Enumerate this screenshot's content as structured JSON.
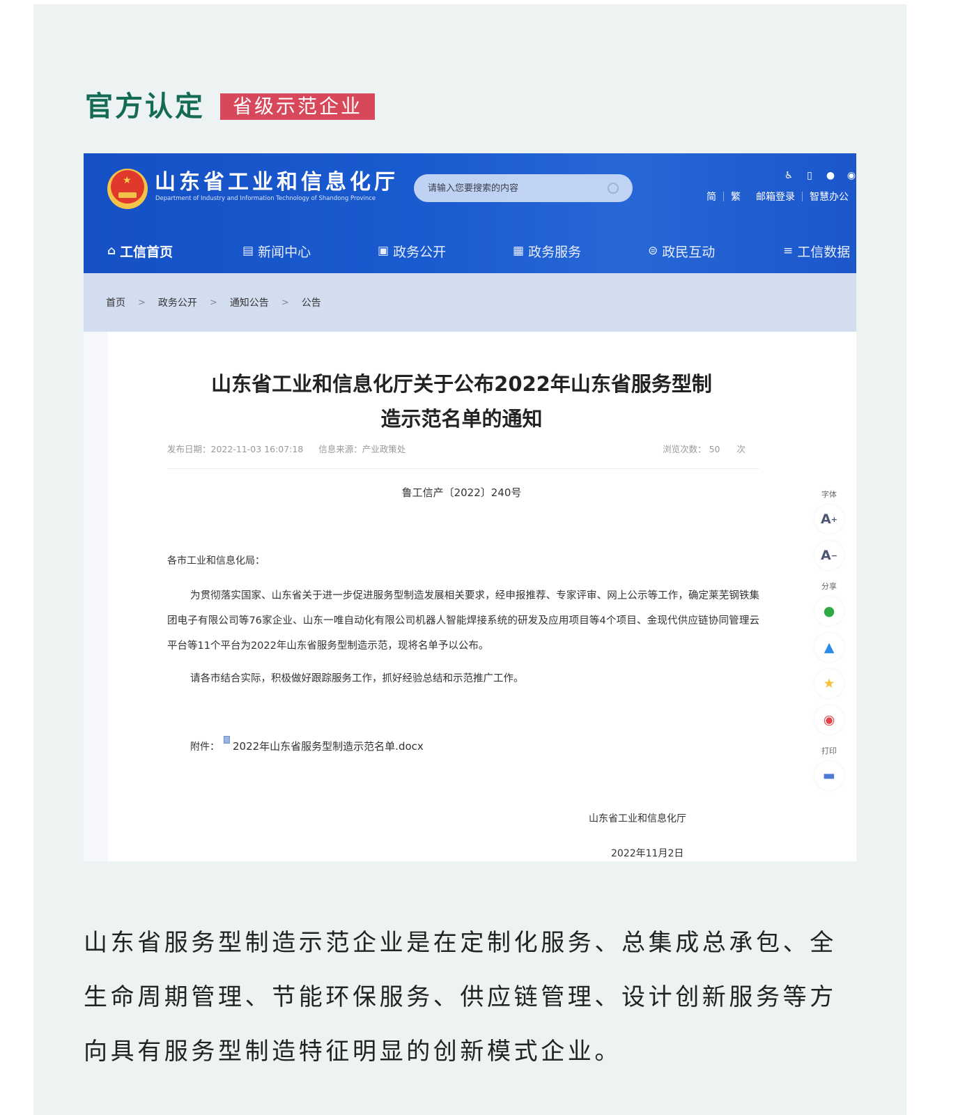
{
  "section": {
    "title": "官方认定",
    "badge": "省级示范企业",
    "colors": {
      "title": "#146b55",
      "badge_bg": "#d6485a"
    }
  },
  "site": {
    "name": "山东省工业和信息化厅",
    "name_en": "Department of Industry and Information Technology of Shandong Province",
    "search_placeholder": "请输入您要搜索的内容",
    "top_icons": [
      "accessibility-icon",
      "mobile-icon",
      "wechat-icon",
      "weibo-icon"
    ],
    "top_links": {
      "simplified": "简",
      "traditional": "繁",
      "mail_login": "邮箱登录",
      "smart_office": "智慧办公"
    },
    "nav": [
      {
        "label": "工信首页",
        "icon": "home-icon",
        "active": true
      },
      {
        "label": "新闻中心",
        "icon": "document-icon",
        "active": false
      },
      {
        "label": "政务公开",
        "icon": "monitor-icon",
        "active": false
      },
      {
        "label": "政务服务",
        "icon": "service-icon",
        "active": false
      },
      {
        "label": "政民互动",
        "icon": "chat-icon",
        "active": false
      },
      {
        "label": "工信数据",
        "icon": "database-icon",
        "active": false
      }
    ],
    "breadcrumb": [
      "首页",
      "政务公开",
      "通知公告",
      "公告"
    ],
    "breadcrumb_sep": ">",
    "colors": {
      "header": "#1a5bd0",
      "breadcrumb_bg": "#d3ddf0"
    }
  },
  "article": {
    "title_line1": "山东省工业和信息化厅关于公布2022年山东省服务型制",
    "title_line2": "造示范名单的通知",
    "publish_date": "发布日期：2022-11-03 16:07:18",
    "source": "信息来源：产业政策处",
    "views_label": "浏览次数：",
    "views_count": "50",
    "views_unit": "次",
    "doc_number": "鲁工信产〔2022〕240号",
    "addressee": "各市工业和信息化局：",
    "paragraph1": "为贯彻落实国家、山东省关于进一步促进服务型制造发展相关要求，经申报推荐、专家评审、网上公示等工作，确定莱芜钢铁集团电子有限公司等76家企业、山东一唯自动化有限公司机器人智能焊接系统的研发及应用项目等4个项目、金现代供应链协同管理云平台等11个平台为2022年山东省服务型制造示范，现将名单予以公布。",
    "paragraph2": "请各市结合实际，积极做好跟踪服务工作，抓好经验总结和示范推广工作。",
    "attachment_label": "附件：",
    "attachment_file": "2022年山东省服务型制造示范名单.docx",
    "signature_org": "山东省工业和信息化厅",
    "signature_date": "2022年11月2日"
  },
  "toolbar": {
    "font_label": "字体",
    "font_increase": "A",
    "font_increase_sup": "+",
    "font_decrease": "A",
    "font_decrease_sup": "−",
    "share_label": "分享",
    "share_items": [
      "wechat-icon",
      "qq-icon",
      "qzone-icon",
      "weibo-icon"
    ],
    "print_label": "打印"
  },
  "description": "山东省服务型制造示范企业是在定制化服务、总集成总承包、全生命周期管理、节能环保服务、供应链管理、设计创新服务等方向具有服务型制造特征明显的创新模式企业。"
}
